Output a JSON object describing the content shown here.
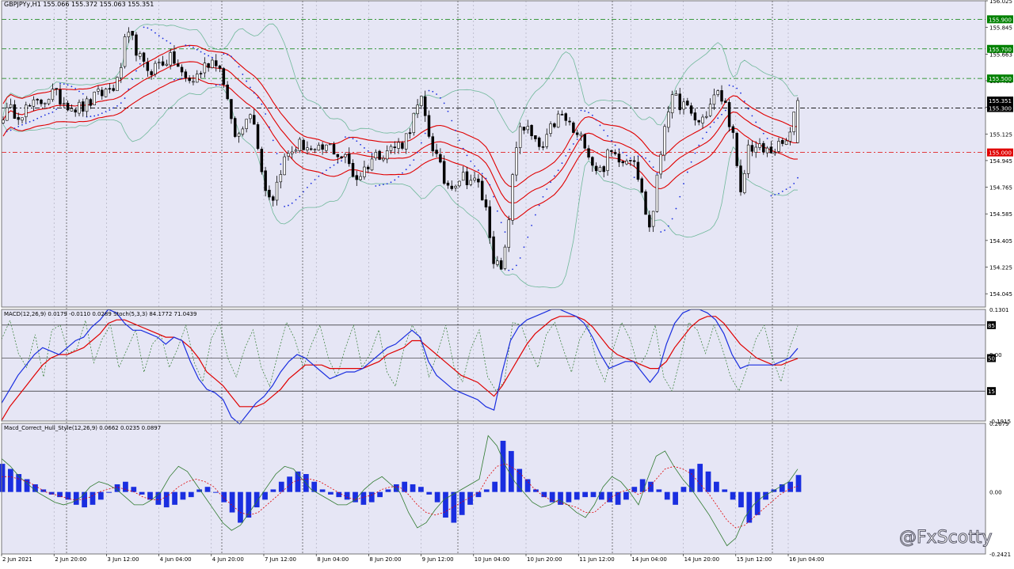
{
  "window": {
    "symbol_caption": "GBPJPYy,H1  155.066 155.372 155.063 155.351",
    "watermark": "@FxScotty"
  },
  "colors": {
    "plot_bg": "#e6e6f5",
    "axis_bg": "#ffffff",
    "bull": "#ffffff",
    "bear": "#000000",
    "band_outer": "#6fb89a",
    "band_inner": "#e00000",
    "sar": "#1a2ee0",
    "macd": "#1a2ee0",
    "signal": "#e00000",
    "stoch": "#2f7a2f",
    "hist": "#1a2ee0",
    "level_green": "#008000",
    "level_red": "#e00000",
    "level_black": "#000000"
  },
  "chart_data": [
    {
      "type": "candlestick",
      "panel": "price",
      "symbol": "GBPJPYy",
      "timeframe": "H1",
      "ohlc_current": {
        "open": 155.066,
        "high": 155.372,
        "low": 155.063,
        "close": 155.351
      },
      "ylim": [
        153.955,
        156.025
      ],
      "yticks": [
        "156.025",
        "155.845",
        "155.663",
        "155.485",
        "155.305",
        "155.125",
        "154.945",
        "154.765",
        "154.585",
        "154.405",
        "154.225",
        "154.045"
      ],
      "x_labels": [
        "2 Jun 2021",
        "2 Jun 20:00",
        "3 Jun 12:00",
        "4 Jun 04:00",
        "4 Jun 20:00",
        "7 Jun 12:00",
        "8 Jun 04:00",
        "8 Jun 20:00",
        "9 Jun 12:00",
        "10 Jun 04:00",
        "10 Jun 20:00",
        "11 Jun 12:00",
        "14 Jun 04:00",
        "14 Jun 20:00",
        "15 Jun 12:00",
        "16 Jun 04:00"
      ],
      "close_path": [
        155.26,
        155.28,
        155.27,
        155.3,
        155.32,
        155.36,
        155.4,
        155.36,
        155.33,
        155.3,
        155.31,
        155.36,
        155.4,
        155.43,
        155.47,
        155.78,
        155.74,
        155.58,
        155.56,
        155.6,
        155.63,
        155.62,
        155.5,
        155.48,
        155.54,
        155.61,
        155.63,
        155.48,
        155.13,
        155.11,
        155.33,
        155.1,
        154.75,
        154.7,
        154.92,
        155.0,
        155.05,
        155.05,
        154.98,
        155.02,
        155.04,
        154.98,
        154.95,
        154.82,
        154.88,
        154.96,
        155.0,
        155.02,
        155.04,
        155.08,
        155.22,
        155.35,
        155.12,
        154.95,
        154.78,
        154.8,
        154.84,
        154.82,
        154.78,
        154.6,
        154.25,
        154.18,
        154.72,
        155.2,
        155.15,
        155.05,
        155.02,
        155.18,
        155.25,
        155.2,
        155.1,
        155.08,
        154.92,
        154.87,
        155.0,
        154.98,
        154.96,
        154.99,
        154.7,
        154.47,
        154.88,
        155.3,
        155.36,
        155.32,
        155.25,
        155.2,
        155.28,
        155.4,
        155.35,
        155.15,
        154.68,
        155.05,
        155.03,
        155.0,
        155.02,
        155.04,
        155.1,
        155.351
      ],
      "levels": [
        {
          "value": 155.9,
          "label": "155.900",
          "role": "green"
        },
        {
          "value": 155.7,
          "label": "155.700",
          "role": "green"
        },
        {
          "value": 155.5,
          "label": "155.500",
          "role": "green"
        },
        {
          "value": 155.351,
          "label": "155.351",
          "role": "current"
        },
        {
          "value": 155.3,
          "label": "155.300",
          "role": "black"
        },
        {
          "value": 155.0,
          "label": "155.000",
          "role": "red"
        }
      ],
      "indicators": [
        "Bollinger Bands",
        "Envelopes",
        "Parabolic SAR"
      ]
    },
    {
      "type": "line",
      "panel": "macd_stoch",
      "caption": "MACD(12,26,9) 0.0179 -0.0110 0.0289  Stoch(5,3,3) 84.1772 71.0439",
      "ylim": [
        -0.1915,
        0.1301
      ],
      "yticks": [
        "0.1301",
        "0.00",
        "-0.1915"
      ],
      "stoch_levels": [
        85,
        50,
        15
      ],
      "stoch_level_labels": [
        "85",
        "50",
        "15"
      ],
      "series": [
        {
          "name": "MACD(12,26,9)",
          "values": [
            -0.14,
            -0.1,
            -0.06,
            -0.03,
            0.0,
            0.02,
            0.01,
            0.0,
            0.02,
            0.04,
            0.05,
            0.08,
            0.1,
            0.13,
            0.12,
            0.09,
            0.07,
            0.07,
            0.06,
            0.05,
            0.03,
            0.05,
            0.04,
            -0.02,
            -0.07,
            -0.1,
            -0.11,
            -0.13,
            -0.18,
            -0.2,
            -0.17,
            -0.14,
            -0.12,
            -0.09,
            -0.05,
            -0.02,
            0.0,
            -0.01,
            -0.03,
            -0.05,
            -0.07,
            -0.06,
            -0.05,
            -0.05,
            -0.04,
            -0.02,
            0.0,
            0.02,
            0.03,
            0.05,
            0.07,
            0.05,
            -0.02,
            -0.06,
            -0.08,
            -0.1,
            -0.11,
            -0.12,
            -0.13,
            -0.15,
            -0.16,
            -0.05,
            0.04,
            0.08,
            0.1,
            0.11,
            0.12,
            0.13,
            0.13,
            0.12,
            0.11,
            0.09,
            0.05,
            0.0,
            -0.04,
            -0.03,
            -0.02,
            -0.02,
            -0.05,
            -0.08,
            -0.05,
            0.03,
            0.09,
            0.12,
            0.13,
            0.13,
            0.12,
            0.1,
            0.06,
            0.0,
            -0.04,
            -0.03,
            -0.03,
            -0.03,
            -0.03,
            -0.02,
            -0.01,
            0.0179
          ]
        },
        {
          "name": "Signal",
          "values": [
            -0.19,
            -0.15,
            -0.12,
            -0.09,
            -0.06,
            -0.03,
            -0.01,
            0.0,
            0.0,
            0.01,
            0.02,
            0.04,
            0.06,
            0.09,
            0.1,
            0.1,
            0.09,
            0.08,
            0.07,
            0.06,
            0.05,
            0.05,
            0.04,
            0.02,
            -0.01,
            -0.05,
            -0.07,
            -0.09,
            -0.12,
            -0.15,
            -0.15,
            -0.15,
            -0.14,
            -0.12,
            -0.1,
            -0.07,
            -0.05,
            -0.03,
            -0.03,
            -0.03,
            -0.04,
            -0.04,
            -0.04,
            -0.04,
            -0.04,
            -0.03,
            -0.02,
            0.0,
            0.01,
            0.02,
            0.04,
            0.04,
            0.02,
            0.0,
            -0.02,
            -0.04,
            -0.06,
            -0.07,
            -0.08,
            -0.1,
            -0.12,
            -0.09,
            -0.05,
            -0.01,
            0.03,
            0.06,
            0.08,
            0.1,
            0.11,
            0.11,
            0.11,
            0.1,
            0.08,
            0.05,
            0.02,
            0.0,
            -0.01,
            -0.02,
            -0.03,
            -0.04,
            -0.04,
            -0.02,
            0.02,
            0.05,
            0.08,
            0.1,
            0.11,
            0.11,
            0.09,
            0.06,
            0.03,
            0.01,
            -0.01,
            -0.02,
            -0.03,
            -0.03,
            -0.02,
            -0.011
          ]
        },
        {
          "name": "Stoch(5,3,3)",
          "values": [
            70,
            90,
            55,
            40,
            75,
            30,
            80,
            85,
            55,
            60,
            90,
            45,
            70,
            85,
            40,
            60,
            80,
            35,
            65,
            75,
            40,
            60,
            85,
            45,
            25,
            70,
            88,
            50,
            30,
            60,
            80,
            40,
            20,
            55,
            88,
            70,
            40,
            65,
            85,
            50,
            30,
            60,
            85,
            40,
            55,
            80,
            35,
            20,
            60,
            85,
            70,
            30,
            55,
            85,
            40,
            25,
            60,
            80,
            30,
            15,
            25,
            88,
            85,
            60,
            40,
            75,
            88,
            60,
            35,
            70,
            85,
            45,
            25,
            60,
            88,
            70,
            40,
            55,
            85,
            30,
            15,
            50,
            88,
            80,
            55,
            85,
            60,
            30,
            15,
            40,
            70,
            85,
            50,
            25,
            60,
            84.2
          ]
        }
      ]
    },
    {
      "type": "bar",
      "panel": "macd_hull",
      "caption": "Macd_Correct_Hull_Style(12,26,9) 0.0662 0.0235 0.0897",
      "ylim": [
        -0.2421,
        0.2679
      ],
      "yticks": [
        "0.2679",
        "0.00",
        "-0.2421"
      ],
      "series": [
        {
          "name": "Histogram",
          "values": [
            0.11,
            0.09,
            0.07,
            0.05,
            0.03,
            0.01,
            -0.01,
            -0.02,
            -0.03,
            -0.05,
            -0.06,
            -0.05,
            -0.03,
            0.0,
            0.03,
            0.04,
            0.02,
            -0.01,
            -0.03,
            -0.05,
            -0.06,
            -0.05,
            -0.03,
            -0.02,
            0.01,
            0.02,
            0.0,
            -0.04,
            -0.08,
            -0.12,
            -0.1,
            -0.06,
            -0.03,
            0.01,
            0.04,
            0.06,
            0.08,
            0.07,
            0.04,
            0.01,
            -0.01,
            -0.02,
            -0.03,
            -0.04,
            -0.05,
            -0.04,
            -0.02,
            0.01,
            0.03,
            0.04,
            0.03,
            0.02,
            -0.01,
            -0.04,
            -0.1,
            -0.12,
            -0.09,
            -0.05,
            -0.02,
            0.01,
            0.04,
            0.2,
            0.16,
            0.09,
            0.05,
            0.01,
            -0.02,
            -0.04,
            -0.05,
            -0.04,
            -0.03,
            -0.02,
            -0.02,
            -0.03,
            -0.04,
            -0.05,
            -0.03,
            0.02,
            0.05,
            0.04,
            0.01,
            -0.03,
            -0.05,
            0.02,
            0.09,
            0.11,
            0.08,
            0.04,
            0.01,
            -0.03,
            -0.06,
            -0.12,
            -0.09,
            -0.03,
            0.01,
            0.03,
            0.04,
            0.0662
          ]
        },
        {
          "name": "MACD",
          "values": [
            0.13,
            0.1,
            0.06,
            0.03,
            0.0,
            -0.02,
            -0.04,
            -0.05,
            -0.04,
            -0.02,
            0.02,
            0.04,
            0.03,
            0.01,
            -0.02,
            -0.05,
            -0.05,
            -0.03,
            0.0,
            0.06,
            0.1,
            0.08,
            0.03,
            -0.02,
            -0.07,
            -0.12,
            -0.15,
            -0.13,
            -0.08,
            -0.03,
            0.02,
            0.07,
            0.1,
            0.09,
            0.05,
            0.01,
            -0.01,
            -0.03,
            -0.05,
            -0.05,
            -0.03,
            0.01,
            0.04,
            0.06,
            0.03,
            0.0,
            -0.08,
            -0.14,
            -0.12,
            -0.07,
            -0.03,
            -0.01,
            0.01,
            0.03,
            0.05,
            0.22,
            0.18,
            0.1,
            0.04,
            0.0,
            -0.04,
            -0.06,
            -0.05,
            -0.03,
            -0.05,
            -0.08,
            -0.1,
            -0.05,
            0.02,
            0.06,
            0.04,
            0.0,
            -0.05,
            0.05,
            0.14,
            0.16,
            0.1,
            0.05,
            0.01,
            -0.04,
            -0.09,
            -0.15,
            -0.21,
            -0.18,
            -0.1,
            -0.05,
            -0.02,
            0.0,
            0.02,
            0.04,
            0.0897
          ]
        },
        {
          "name": "Signal",
          "values": [
            0.06,
            0.06,
            0.05,
            0.04,
            0.02,
            0.0,
            -0.01,
            -0.02,
            -0.03,
            -0.03,
            -0.02,
            0.0,
            0.01,
            0.02,
            0.01,
            0.0,
            -0.02,
            -0.03,
            -0.03,
            -0.01,
            0.02,
            0.04,
            0.05,
            0.04,
            0.02,
            -0.02,
            -0.05,
            -0.08,
            -0.09,
            -0.08,
            -0.05,
            -0.02,
            0.01,
            0.04,
            0.05,
            0.05,
            0.04,
            0.02,
            0.0,
            -0.02,
            -0.03,
            -0.02,
            -0.01,
            0.01,
            0.02,
            0.02,
            -0.01,
            -0.05,
            -0.08,
            -0.09,
            -0.08,
            -0.06,
            -0.04,
            -0.02,
            0.0,
            0.06,
            0.1,
            0.11,
            0.09,
            0.06,
            0.02,
            -0.01,
            -0.03,
            -0.04,
            -0.05,
            -0.06,
            -0.08,
            -0.08,
            -0.05,
            -0.02,
            0.0,
            0.01,
            -0.01,
            0.01,
            0.05,
            0.09,
            0.1,
            0.09,
            0.07,
            0.03,
            -0.01,
            -0.06,
            -0.11,
            -0.14,
            -0.13,
            -0.1,
            -0.07,
            -0.04,
            -0.01,
            0.01,
            0.0235
          ]
        }
      ]
    }
  ]
}
